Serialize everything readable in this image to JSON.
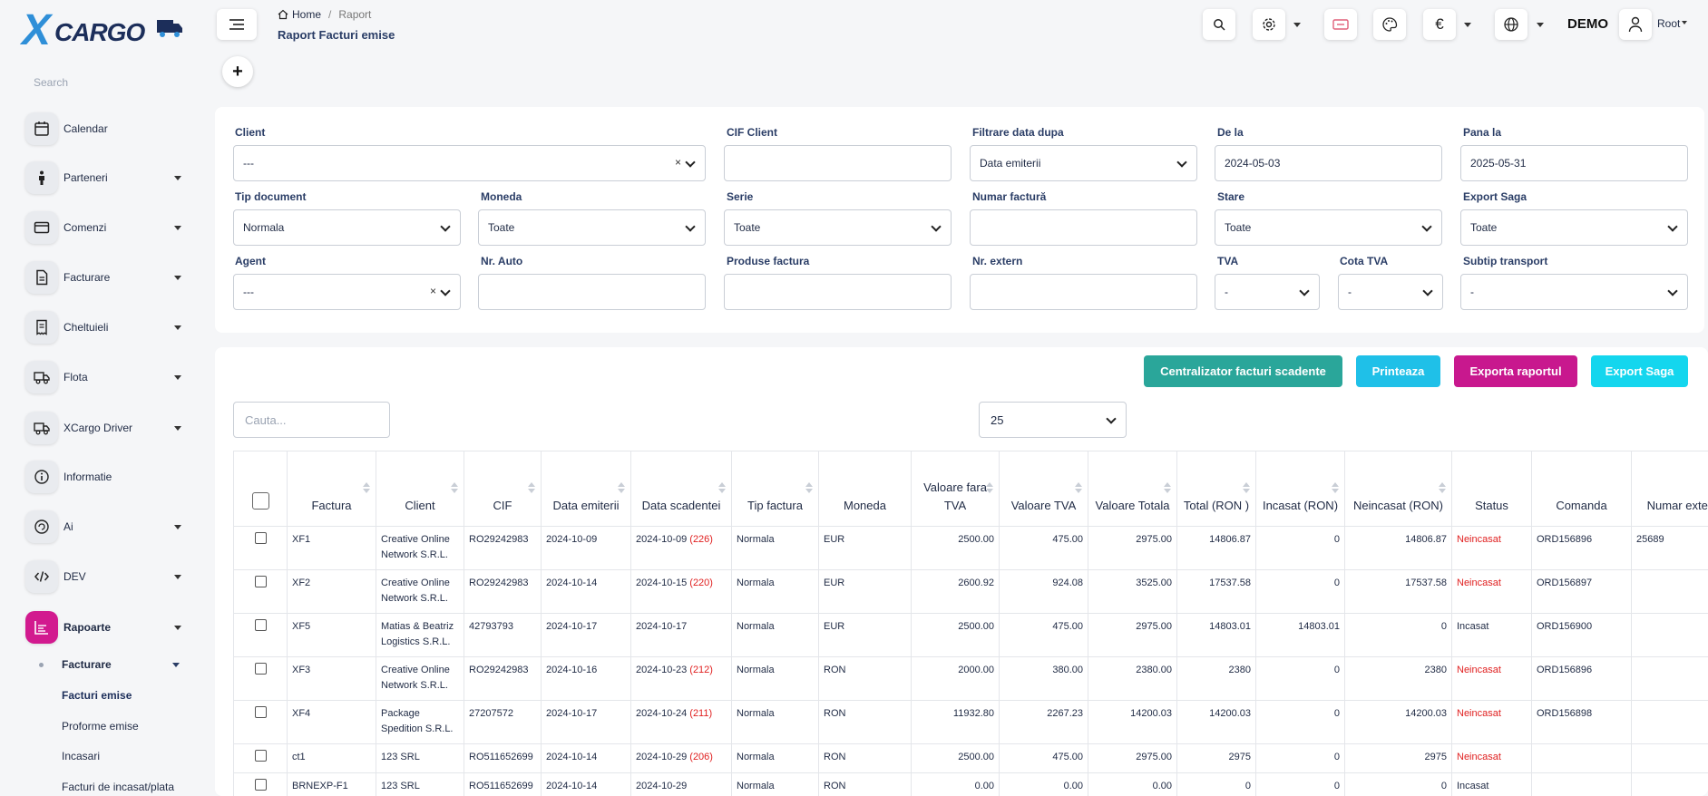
{
  "brand": {
    "x": "X",
    "name": "CARGO"
  },
  "sidebar": {
    "search_placeholder": "Search",
    "items": [
      {
        "label": "Calendar"
      },
      {
        "label": "Parteneri"
      },
      {
        "label": "Comenzi"
      },
      {
        "label": "Facturare"
      },
      {
        "label": "Cheltuieli"
      },
      {
        "label": "Flota"
      },
      {
        "label": "XCargo Driver"
      },
      {
        "label": "Informatie"
      },
      {
        "label": "Ai"
      },
      {
        "label": "DEV"
      },
      {
        "label": "Rapoarte"
      }
    ],
    "sub_group": "Facturare",
    "sub_items": [
      "Facturi emise",
      "Proforme emise",
      "Incasari",
      "Facturi de incasat/plata"
    ]
  },
  "header": {
    "breadcrumb_home": "Home",
    "breadcrumb_sep": "/",
    "breadcrumb_current": "Raport",
    "title": "Raport Facturi emise",
    "currency_symbol": "€",
    "company": "DEMO",
    "user": "Root"
  },
  "filters": {
    "client": {
      "label": "Client",
      "value": "---",
      "clear": "×"
    },
    "cif_client": {
      "label": "CIF Client",
      "value": ""
    },
    "filtrare_data": {
      "label": "Filtrare data dupa",
      "value": "Data emiterii"
    },
    "de_la": {
      "label": "De la",
      "value": "2024-05-03"
    },
    "pana_la": {
      "label": "Pana la",
      "value": "2025-05-31"
    },
    "tip_document": {
      "label": "Tip document",
      "value": "Normala"
    },
    "moneda": {
      "label": "Moneda",
      "value": "Toate"
    },
    "serie": {
      "label": "Serie",
      "value": "Toate"
    },
    "numar_factura": {
      "label": "Numar factură",
      "value": ""
    },
    "stare": {
      "label": "Stare",
      "value": "Toate"
    },
    "export_saga": {
      "label": "Export Saga",
      "value": "Toate"
    },
    "agent": {
      "label": "Agent",
      "value": "---",
      "clear": "×"
    },
    "nr_auto": {
      "label": "Nr. Auto",
      "value": ""
    },
    "produse_factura": {
      "label": "Produse factura",
      "value": ""
    },
    "nr_extern": {
      "label": "Nr. extern",
      "value": ""
    },
    "tva": {
      "label": "TVA",
      "value": "-"
    },
    "cota_tva": {
      "label": "Cota TVA",
      "value": "-"
    },
    "subtip_transport": {
      "label": "Subtip transport",
      "value": "-"
    }
  },
  "actions": {
    "centralizator": "Centralizator facturi scadente",
    "printeaza": "Printeaza",
    "exporta": "Exporta raportul",
    "export_saga": "Export Saga",
    "colors": {
      "centralizator": "#2aa69a",
      "printeaza": "#1fc0e8",
      "exporta": "#c8188e",
      "export_saga": "#14d6ee"
    }
  },
  "table": {
    "search_placeholder": "Cauta...",
    "page_size": "25",
    "headers": [
      "Factura",
      "Client",
      "CIF",
      "Data emiterii",
      "Data scadentei",
      "Tip factura",
      "Moneda",
      "Valoare fara TVA",
      "Valoare TVA",
      "Valoare Totala",
      "Total (RON )",
      "Incasat (RON)",
      "Neincasat (RON)",
      "Status",
      "Comanda",
      "Numar extern"
    ],
    "rows": [
      {
        "factura": "XF1",
        "client": "Creative Online Network S.R.L.",
        "cif": "RO29242983",
        "emitere": "2024-10-09",
        "scadenta": "2024-10-09",
        "overdue": "(226)",
        "tip": "Normala",
        "moneda": "EUR",
        "fara_tva": "2500.00",
        "tva": "475.00",
        "totala": "2975.00",
        "total_ron": "14806.87",
        "incasat": "0",
        "neincasat": "14806.87",
        "status": "Neincasat",
        "comanda": "ORD156896",
        "extern": "25689"
      },
      {
        "factura": "XF2",
        "client": "Creative Online Network S.R.L.",
        "cif": "RO29242983",
        "emitere": "2024-10-14",
        "scadenta": "2024-10-15",
        "overdue": "(220)",
        "tip": "Normala",
        "moneda": "EUR",
        "fara_tva": "2600.92",
        "tva": "924.08",
        "totala": "3525.00",
        "total_ron": "17537.58",
        "incasat": "0",
        "neincasat": "17537.58",
        "status": "Neincasat",
        "comanda": "ORD156897",
        "extern": ""
      },
      {
        "factura": "XF5",
        "client": "Matias & Beatriz Logistics S.R.L.",
        "cif": "42793793",
        "emitere": "2024-10-17",
        "scadenta": "2024-10-17",
        "overdue": "",
        "tip": "Normala",
        "moneda": "EUR",
        "fara_tva": "2500.00",
        "tva": "475.00",
        "totala": "2975.00",
        "total_ron": "14803.01",
        "incasat": "14803.01",
        "neincasat": "0",
        "status": "Incasat",
        "comanda": "ORD156900",
        "extern": ""
      },
      {
        "factura": "XF3",
        "client": "Creative Online Network S.R.L.",
        "cif": "RO29242983",
        "emitere": "2024-10-16",
        "scadenta": "2024-10-23",
        "overdue": "(212)",
        "tip": "Normala",
        "moneda": "RON",
        "fara_tva": "2000.00",
        "tva": "380.00",
        "totala": "2380.00",
        "total_ron": "2380",
        "incasat": "0",
        "neincasat": "2380",
        "status": "Neincasat",
        "comanda": "ORD156896",
        "extern": ""
      },
      {
        "factura": "XF4",
        "client": "Package Spedition S.R.L.",
        "cif": "27207572",
        "emitere": "2024-10-17",
        "scadenta": "2024-10-24",
        "overdue": "(211)",
        "tip": "Normala",
        "moneda": "RON",
        "fara_tva": "11932.80",
        "tva": "2267.23",
        "totala": "14200.03",
        "total_ron": "14200.03",
        "incasat": "0",
        "neincasat": "14200.03",
        "status": "Neincasat",
        "comanda": "ORD156898",
        "extern": ""
      },
      {
        "factura": "ct1",
        "client": "123 SRL",
        "cif": "RO511652699",
        "emitere": "2024-10-14",
        "scadenta": "2024-10-29",
        "overdue": "(206)",
        "tip": "Normala",
        "moneda": "RON",
        "fara_tva": "2500.00",
        "tva": "475.00",
        "totala": "2975.00",
        "total_ron": "2975",
        "incasat": "0",
        "neincasat": "2975",
        "status": "Neincasat",
        "comanda": "",
        "extern": ""
      },
      {
        "factura": "BRNEXP-F1",
        "client": "123 SRL",
        "cif": "RO511652699",
        "emitere": "2024-10-14",
        "scadenta": "2024-10-29",
        "overdue": "",
        "tip": "Normala",
        "moneda": "RON",
        "fara_tva": "0.00",
        "tva": "0.00",
        "totala": "0.00",
        "total_ron": "0",
        "incasat": "0",
        "neincasat": "0",
        "status": "Incasat",
        "comanda": "",
        "extern": ""
      }
    ]
  },
  "icons": [
    "search-icon",
    "gear-icon",
    "ticket-icon",
    "palette-icon",
    "euro-icon",
    "globe-icon",
    "user-icon",
    "menu-icon",
    "plus-icon",
    "calendar-icon",
    "person-icon",
    "card-icon",
    "document-icon",
    "receipt-icon",
    "truck-icon",
    "info-icon",
    "ai-icon",
    "code-icon",
    "chart-icon"
  ],
  "colors": {
    "accent": "#d21a8f",
    "danger": "#e02020",
    "title": "#2a3d66"
  }
}
